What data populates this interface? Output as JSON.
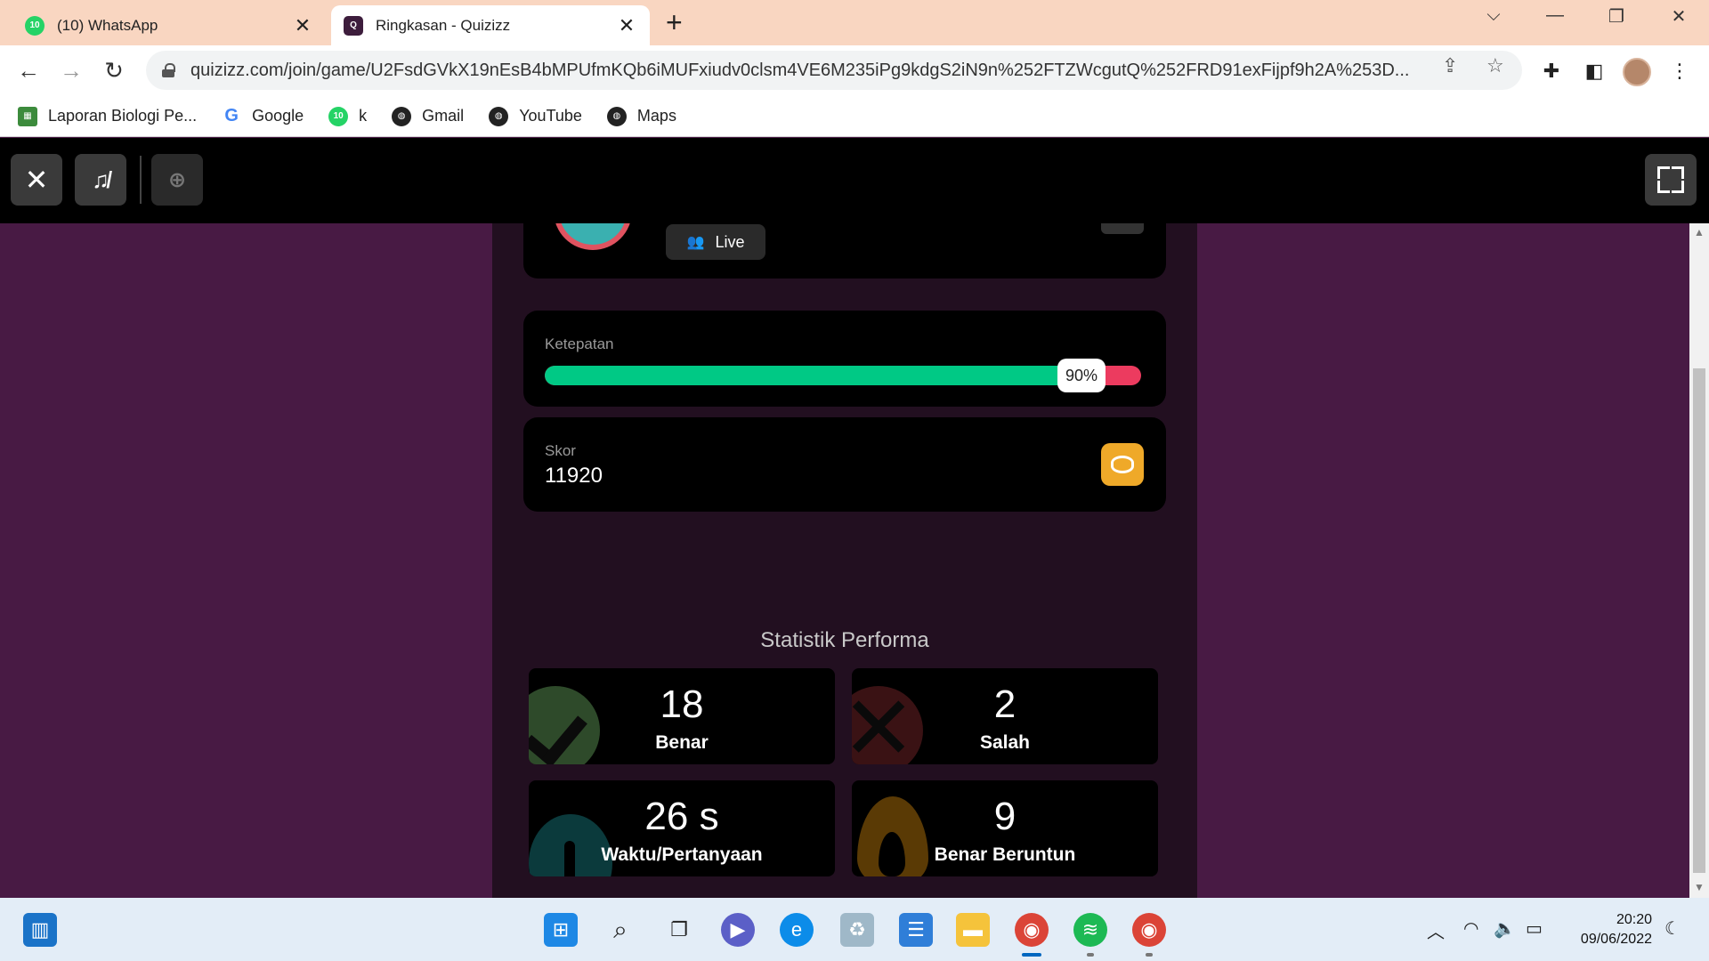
{
  "browser": {
    "tabs": [
      {
        "title": "(10) WhatsApp",
        "badge": "10",
        "active": false
      },
      {
        "title": "Ringkasan - Quizizz",
        "active": true
      }
    ],
    "url": "quizizz.com/join/game/U2FsdGVkX19nEsB4bMPUfmKQb6iMUFxiudv0clsm4VE6M235iPg9kdgS2iN9n%252FTZWcgutQ%252FRD91exFijpf9h2A%253D...",
    "bookmarks": [
      {
        "label": "Laporan Biologi Pe...",
        "icon": "app-icon"
      },
      {
        "label": "Google",
        "icon": "google-icon"
      },
      {
        "label": "k",
        "icon": "whatsapp-icon",
        "badge": "10"
      },
      {
        "label": "Gmail",
        "icon": "globe-icon"
      },
      {
        "label": "YouTube",
        "icon": "globe-icon"
      },
      {
        "label": "Maps",
        "icon": "globe-icon"
      }
    ]
  },
  "quiz": {
    "live_label": "Live",
    "accuracy": {
      "label": "Ketepatan",
      "percent": 90,
      "percent_text": "90%"
    },
    "score": {
      "label": "Skor",
      "value": "11920"
    },
    "stats_title": "Statistik Performa",
    "stats": [
      {
        "value": "18",
        "label": "Benar"
      },
      {
        "value": "2",
        "label": "Salah"
      },
      {
        "value": "26 s",
        "label": "Waktu/Pertanyaan"
      },
      {
        "value": "9",
        "label": "Benar Beruntun"
      }
    ],
    "colors": {
      "correct": "#00c985",
      "incorrect": "#ec3b5f",
      "coin": "#efa929",
      "background": "#481a44"
    }
  },
  "taskbar": {
    "time": "20:20",
    "date": "09/06/2022"
  }
}
